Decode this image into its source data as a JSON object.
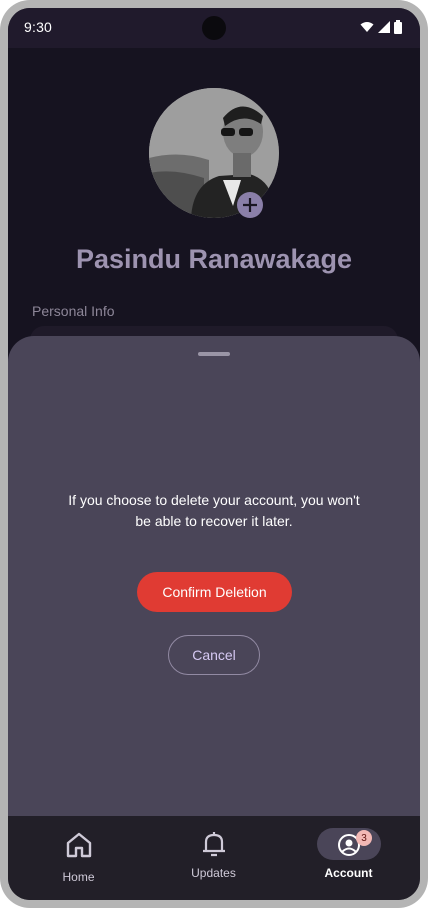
{
  "status_bar": {
    "time": "9:30"
  },
  "profile": {
    "name": "Pasindu Ranawakage",
    "section_label": "Personal Info"
  },
  "sheet": {
    "message": "If you choose to delete your account, you won't be able to recover it later.",
    "confirm_label": "Confirm Deletion",
    "cancel_label": "Cancel"
  },
  "nav": {
    "items": [
      {
        "label": "Home",
        "icon": "home-icon"
      },
      {
        "label": "Updates",
        "icon": "bell-icon"
      },
      {
        "label": "Account",
        "icon": "account-icon",
        "badge": "3",
        "selected": true
      }
    ]
  },
  "colors": {
    "confirm": "#e03b33",
    "sheet": "#4a4558",
    "background": "#161320"
  }
}
